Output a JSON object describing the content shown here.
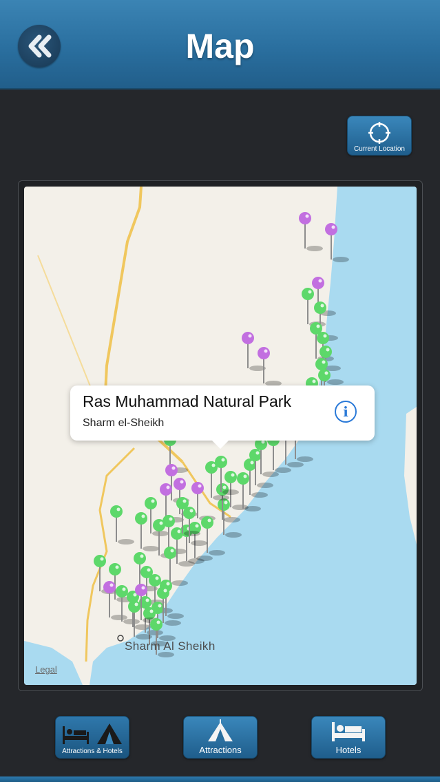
{
  "header": {
    "title": "Map"
  },
  "current_location": {
    "label": "Current Location"
  },
  "map": {
    "city_label": "Sharm Al Sheikh",
    "legal_label": "Legal",
    "callout": {
      "title": "Ras Muhammad Natural Park",
      "subtitle": "Sharm el-Sheikh"
    },
    "colors": {
      "land": "#f3f0e9",
      "water": "#a9daf0",
      "road": "#f0c75e",
      "attraction_pin": "#c26fe0",
      "hotel_pin": "#5dd86a"
    }
  },
  "tabs": [
    {
      "label": "Attractions & Hotels",
      "icon": "bed-and-tent-icon"
    },
    {
      "label": "Attractions",
      "icon": "tent-icon"
    },
    {
      "label": "Hotels",
      "icon": "bed-icon"
    }
  ]
}
